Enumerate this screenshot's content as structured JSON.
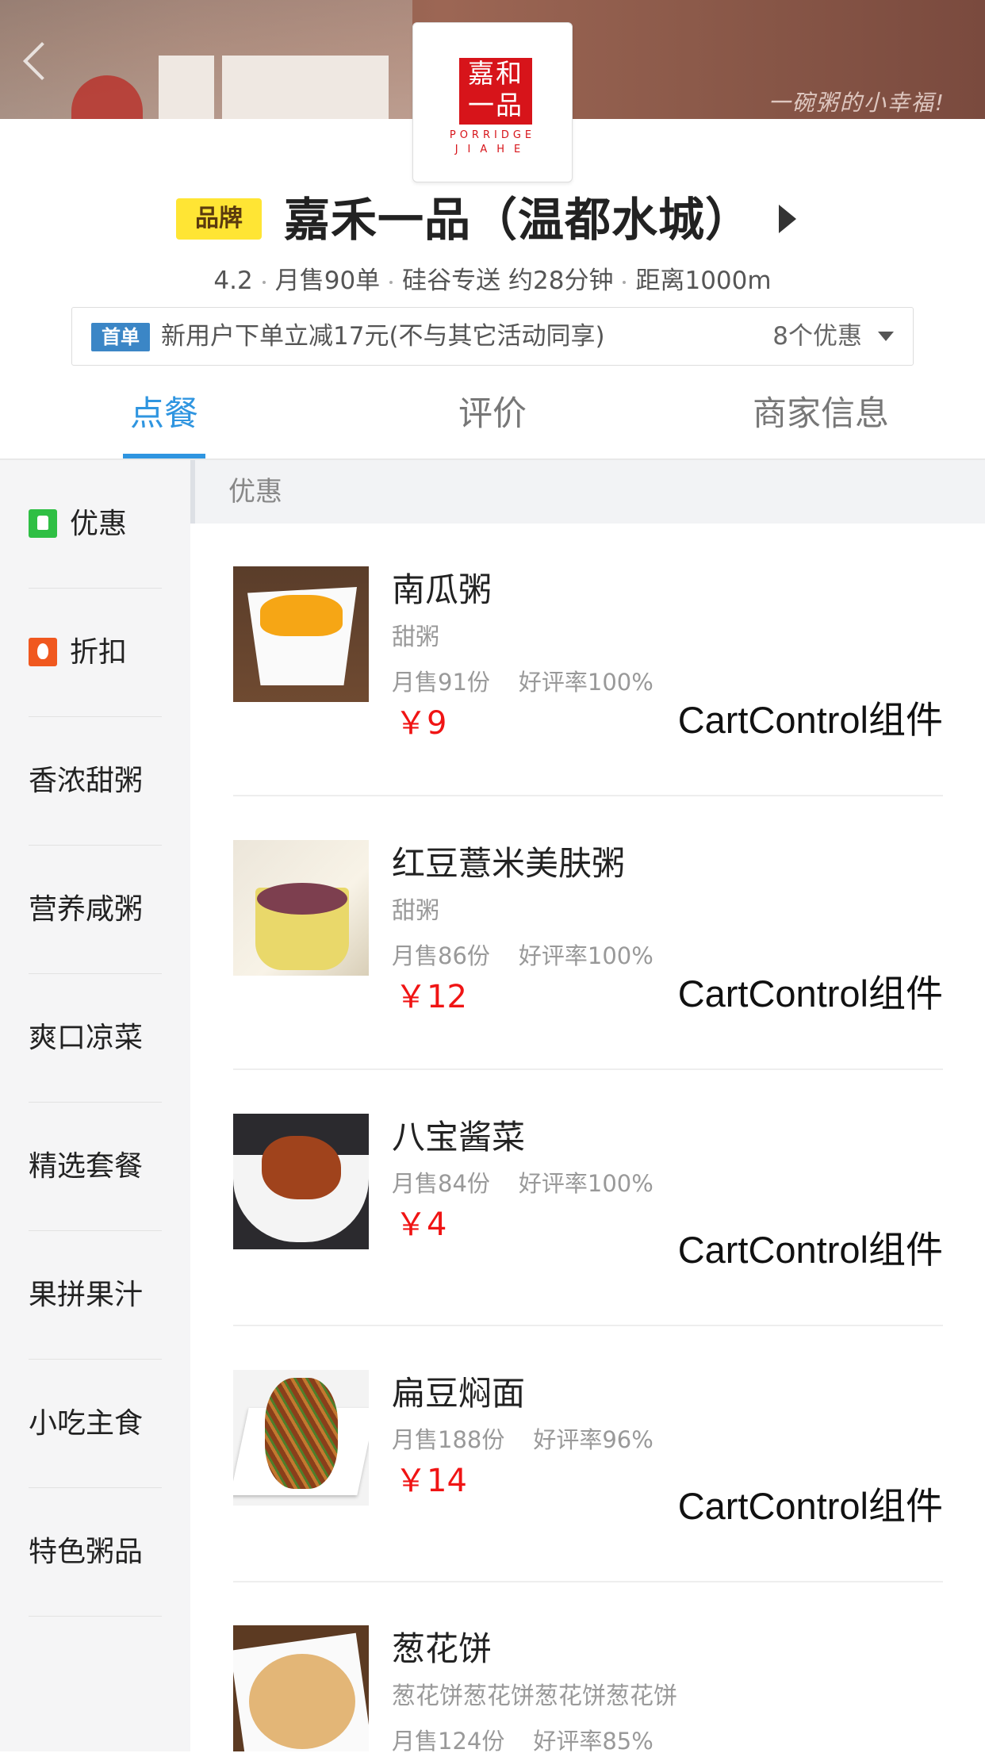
{
  "header": {
    "slogan": "一碗粥的小幸福!",
    "logo": {
      "chars": [
        "嘉和",
        "一品"
      ],
      "sub_line1": "PORRIDGE",
      "sub_line2": "JIAHE"
    }
  },
  "store": {
    "brand_badge": "品牌",
    "name": "嘉禾一品（温都水城）",
    "rating": "4.2",
    "monthly_sales": "月售90单",
    "delivery": "硅谷专送 约28分钟",
    "distance": "距离1000m"
  },
  "promo": {
    "tag": "首单",
    "text": "新用户下单立减17元(不与其它活动同享)",
    "count": "8个优惠"
  },
  "tabs": [
    {
      "label": "点餐",
      "active": true
    },
    {
      "label": "评价",
      "active": false
    },
    {
      "label": "商家信息",
      "active": false
    }
  ],
  "sidebar": {
    "items": [
      {
        "label": "优惠",
        "icon": "discount-tag-icon"
      },
      {
        "label": "折扣",
        "icon": "fire-icon"
      },
      {
        "label": "香浓甜粥"
      },
      {
        "label": "营养咸粥"
      },
      {
        "label": "爽口凉菜"
      },
      {
        "label": "精选套餐"
      },
      {
        "label": "果拼果汁"
      },
      {
        "label": "小吃主食"
      },
      {
        "label": "特色粥品"
      }
    ]
  },
  "section": {
    "title": "优惠"
  },
  "foods": [
    {
      "name": "南瓜粥",
      "desc": "甜粥",
      "sales": "月售91份",
      "rating": "好评率100%",
      "price": "￥9",
      "cart": "CartControl组件"
    },
    {
      "name": "红豆薏米美肤粥",
      "desc": "甜粥",
      "sales": "月售86份",
      "rating": "好评率100%",
      "price": "￥12",
      "cart": "CartControl组件"
    },
    {
      "name": "八宝酱菜",
      "desc": "",
      "sales": "月售84份",
      "rating": "好评率100%",
      "price": "￥4",
      "cart": "CartControl组件"
    },
    {
      "name": "扁豆焖面",
      "desc": "",
      "sales": "月售188份",
      "rating": "好评率96%",
      "price": "￥14",
      "cart": "CartControl组件"
    },
    {
      "name": "葱花饼",
      "desc": "葱花饼葱花饼葱花饼葱花饼",
      "sales": "月售124份",
      "rating": "好评率85%",
      "price": "",
      "cart": ""
    }
  ],
  "colors": {
    "accent": "#2f95e0",
    "price": "#f01414",
    "brand_badge": "#ffe534",
    "promo_tag": "#3b86c6",
    "logo_red": "#d7141a"
  }
}
